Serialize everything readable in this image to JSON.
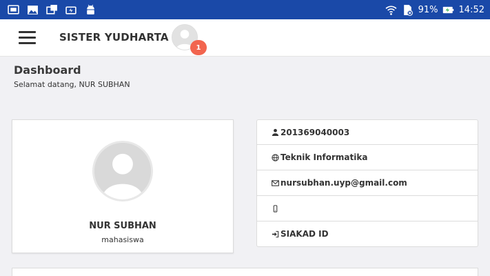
{
  "statusbar": {
    "battery": "91%",
    "time": "14:52",
    "icons": [
      "screen-mirror-icon",
      "image-icon",
      "cast-icon",
      "battery-saver-icon",
      "android-icon",
      "wifi-icon",
      "sim-no-icon",
      "battery-charging-icon"
    ]
  },
  "navbar": {
    "brand": "SISTER YUDHARTA",
    "notification_count": "1"
  },
  "page": {
    "title": "Dashboard",
    "welcome": "Selamat datang, NUR SUBHAN"
  },
  "profile": {
    "name": "NUR SUBHAN",
    "role": "mahasiswa"
  },
  "info": [
    {
      "icon": "user-icon",
      "text": "201369040003"
    },
    {
      "icon": "globe-icon",
      "text": "Teknik Informatika"
    },
    {
      "icon": "envelope-icon",
      "text": "nursubhan.uyp@gmail.com"
    },
    {
      "icon": "mobile-icon",
      "text": ""
    },
    {
      "icon": "sign-in-icon",
      "text": "SIAKAD ID"
    }
  ],
  "colors": {
    "statusbar": "#1a49a8",
    "badge": "#f2654f",
    "background": "#f1f1f4"
  }
}
